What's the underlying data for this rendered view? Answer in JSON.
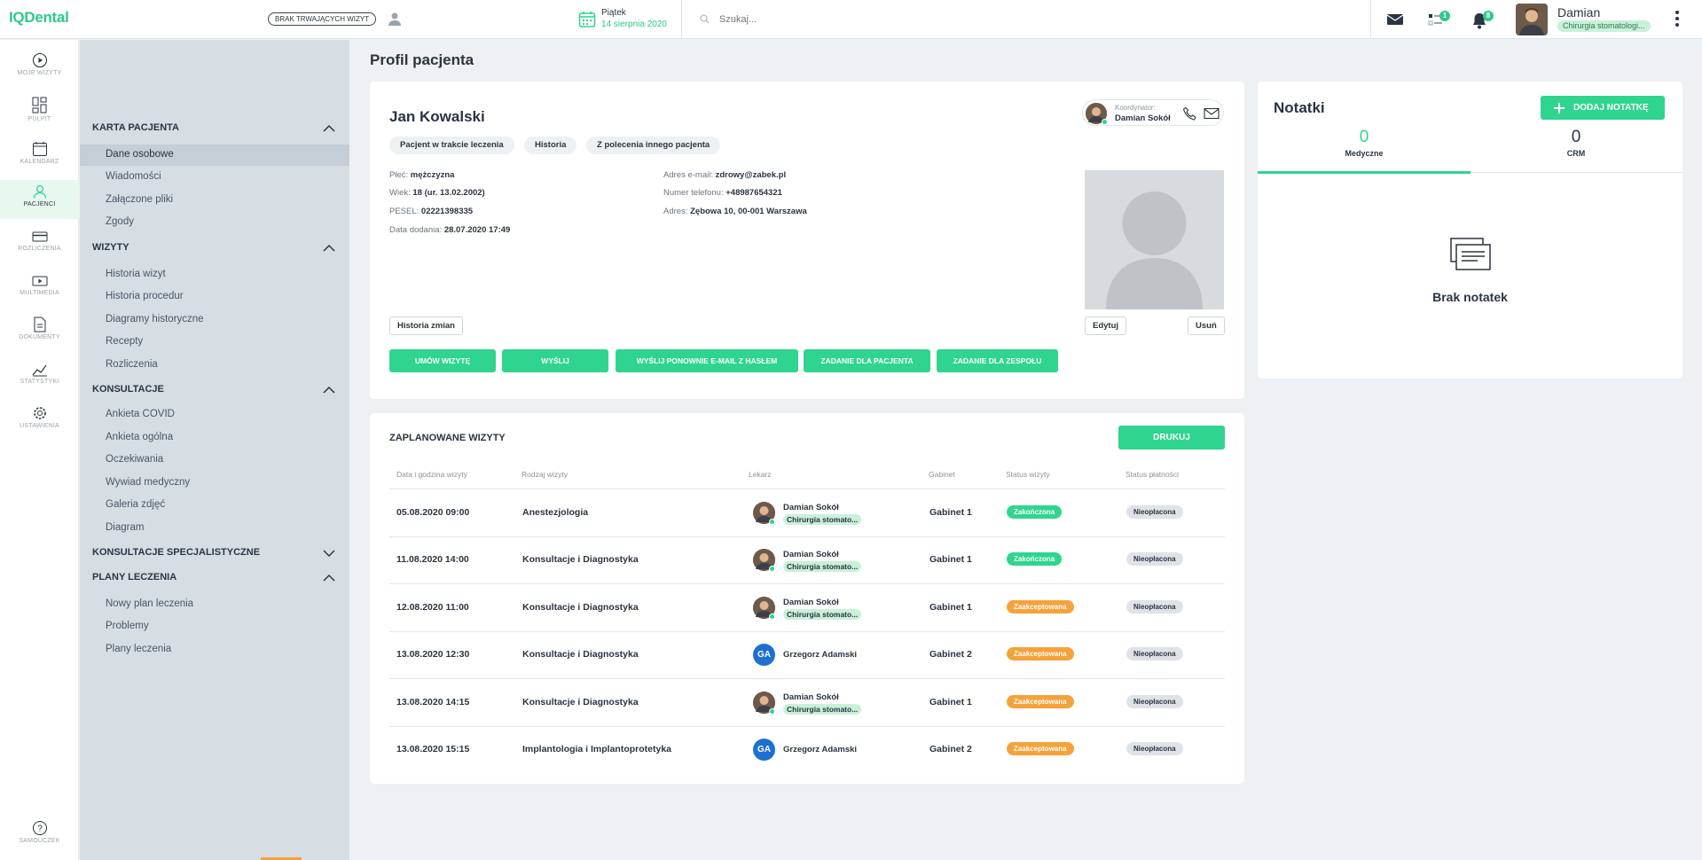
{
  "app": {
    "logo": "IQDental"
  },
  "topbar": {
    "status_pill": "BRAK TRWAJĄCYCH WIZYT",
    "day": "Piątek",
    "date": "14 sierpnia 2020",
    "search_placeholder": "Szukaj...",
    "tasks_badge": "1",
    "notifications_badge": "8",
    "user_name": "Damian",
    "user_role": "Chirurgia stomatologi..."
  },
  "rail": [
    {
      "label": "MOJE WIZYTY",
      "icon": "play-circle-icon"
    },
    {
      "label": "PULPIT",
      "icon": "dashboard-icon"
    },
    {
      "label": "KALENDARZ",
      "icon": "calendar-icon"
    },
    {
      "label": "PACJENCI",
      "icon": "user-icon",
      "active": true
    },
    {
      "label": "ROZLICZENIA",
      "icon": "card-icon"
    },
    {
      "label": "MULTIMEDIA",
      "icon": "media-icon"
    },
    {
      "label": "DOKUMENTY",
      "icon": "document-icon"
    },
    {
      "label": "STATYSTYKI",
      "icon": "chart-icon"
    },
    {
      "label": "USTAWIENIA",
      "icon": "gear-icon"
    },
    {
      "label": "SAMOUCZEK",
      "icon": "help-icon"
    }
  ],
  "submenu": {
    "sections": [
      {
        "title": "KARTA PACJENTA",
        "items": [
          "Dane osobowe",
          "Wiadomości",
          "Załączone pliki",
          "Zgody"
        ]
      },
      {
        "title": "WIZYTY",
        "items": [
          "Historia wizyt",
          "Historia procedur",
          "Diagramy historyczne",
          "Recepty",
          "Rozliczenia"
        ]
      },
      {
        "title": "KONSULTACJE",
        "items": [
          "Ankieta COVID",
          "Ankieta ogólna",
          "Oczekiwania",
          "Wywiad medyczny",
          "Galeria zdjęć",
          "Diagram"
        ]
      },
      {
        "title": "KONSULTACJE SPECJALISTYCZNE",
        "items": []
      },
      {
        "title": "PLANY LECZENIA",
        "items": [
          "Nowy plan leczenia",
          "Problemy",
          "Plany leczenia"
        ]
      }
    ]
  },
  "page_title": "Profil pacjenta",
  "patient": {
    "name": "Jan Kowalski",
    "tags": [
      "Pacjent w trakcie leczenia",
      "Historia",
      "Z polecenia innego pacjenta"
    ],
    "coordinator_label": "Koordynator:",
    "coordinator_name": "Damian Sokół",
    "sex_label": "Płeć:",
    "sex": "mężczyzna",
    "age_label": "Wiek:",
    "age": "18 (ur. 13.02.2002)",
    "pesel_label": "PESEL:",
    "pesel": "02221398335",
    "added_label": "Data dodania:",
    "added": "28.07.2020 17:49",
    "email_label": "Adres e-mail:",
    "email": "zdrowy@zabek.pl",
    "phone_label": "Numer telefonu:",
    "phone": "+48987654321",
    "address_label": "Adres:",
    "address": "Zębowa 10, 00-001 Warszawa",
    "history_button": "Historia zmian",
    "edit_button": "Edytuj",
    "delete_button": "Usuń",
    "actions": [
      "UMÓW WIZYTĘ",
      "WYŚLIJ",
      "WYŚLIJ PONOWNIE E-MAIL Z HASŁEM",
      "ZADANIE DLA PACJENTA",
      "ZADANIE DLA ZESPOŁU"
    ]
  },
  "visits": {
    "title": "ZAPLANOWANE WIZYTY",
    "print_button": "DRUKUJ",
    "headers": [
      "Data i godzina wizyty",
      "Rodzaj wizyty",
      "Lekarz",
      "Gabinet",
      "Status wizyty",
      "Status płatności"
    ],
    "rows": [
      {
        "date": "05.08.2020 09:00",
        "type": "Anestezjologia",
        "doctor": "Damian Sokół",
        "spec": "Chirurgia stomato...",
        "initials": "",
        "room": "Gabinet 1",
        "status": "Zakończona",
        "payment": "Nieopłacona"
      },
      {
        "date": "11.08.2020 14:00",
        "type": "Konsultacje i Diagnostyka",
        "doctor": "Damian Sokół",
        "spec": "Chirurgia stomato...",
        "initials": "",
        "room": "Gabinet 1",
        "status": "Zakończona",
        "payment": "Nieopłacona"
      },
      {
        "date": "12.08.2020 11:00",
        "type": "Konsultacje i Diagnostyka",
        "doctor": "Damian Sokół",
        "spec": "Chirurgia stomato...",
        "initials": "",
        "room": "Gabinet 1",
        "status": "Zaakceptowana",
        "payment": "Nieopłacona"
      },
      {
        "date": "13.08.2020 12:30",
        "type": "Konsultacje i Diagnostyka",
        "doctor": "Grzegorz Adamski",
        "spec": "",
        "initials": "GA",
        "room": "Gabinet 2",
        "status": "Zaakceptowana",
        "payment": "Nieopłacona"
      },
      {
        "date": "13.08.2020 14:15",
        "type": "Konsultacje i Diagnostyka",
        "doctor": "Damian Sokół",
        "spec": "Chirurgia stomato...",
        "initials": "",
        "room": "Gabinet 1",
        "status": "Zaakceptowana",
        "payment": "Nieopłacona"
      },
      {
        "date": "13.08.2020 15:15",
        "type": "Implantologia i Implantoprotetyka",
        "doctor": "Grzegorz Adamski",
        "spec": "",
        "initials": "GA",
        "room": "Gabinet 2",
        "status": "Zaakceptowana",
        "payment": "Nieopłacona"
      }
    ]
  },
  "notes": {
    "title": "Notatki",
    "add_button": "DODAJ NOTATKĘ",
    "tabs": [
      {
        "count": "0",
        "label": "Medyczne"
      },
      {
        "count": "0",
        "label": "CRM"
      }
    ],
    "empty_text": "Brak notatek"
  },
  "colors": {
    "accent": "#2fd58e",
    "warning": "#f5a23a",
    "sidebar": "#d6dee4",
    "blue": "#1f6fd0"
  }
}
